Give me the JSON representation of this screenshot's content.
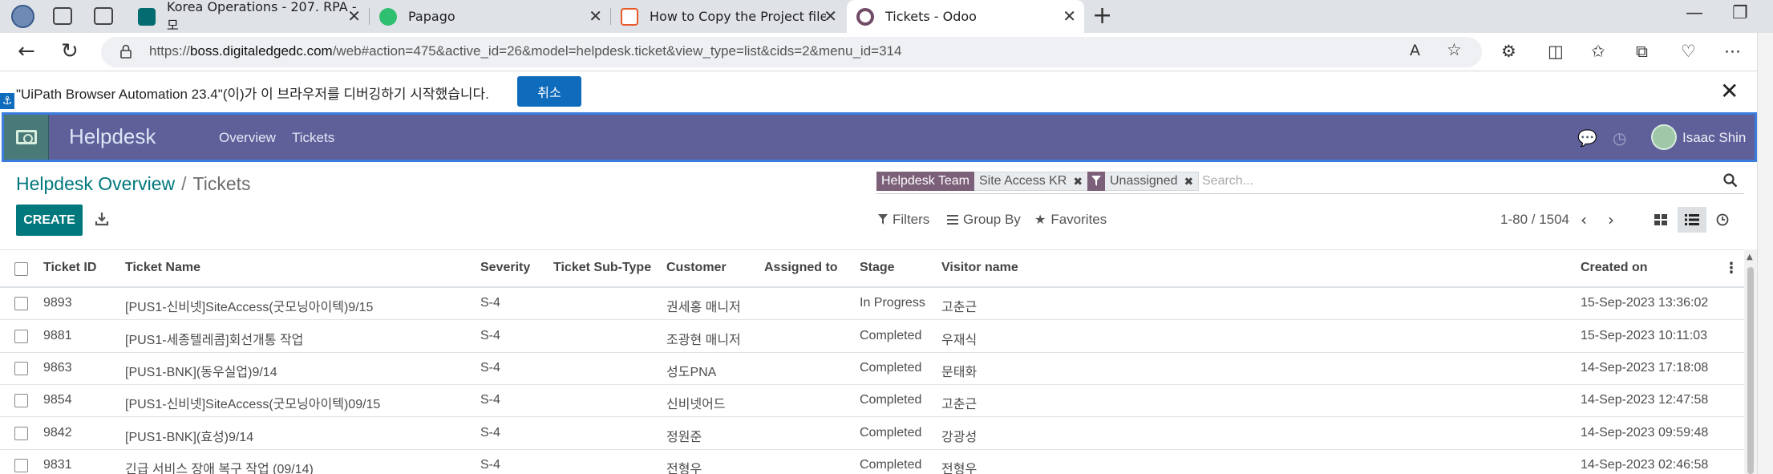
{
  "browser": {
    "tabs": [
      {
        "title": "Korea Operations - 207. RPA - 모",
        "favicon_color": "#036c70"
      },
      {
        "title": "Papago",
        "favicon_color": "#2fbf71"
      },
      {
        "title": "How to Copy the Project file in St",
        "favicon_color": "#e85a28"
      },
      {
        "title": "Tickets - Odoo",
        "favicon_color": "#714b67"
      }
    ],
    "active_tab": 3,
    "url_prefix": "https://",
    "url_host": "boss.digitaledgedc.com",
    "url_path": "/web#action=475&active_id=26&model=helpdesk.ticket&view_type=list&cids=2&menu_id=314"
  },
  "infobar": {
    "message": "\"UiPath Browser Automation 23.4\"(이)가 이 브라우저를 디버깅하기 시작했습니다.",
    "cancel_label": "취소"
  },
  "navbar": {
    "brand": "Helpdesk",
    "menu": [
      "Overview",
      "Tickets"
    ],
    "user": "Isaac Shin"
  },
  "breadcrumb": {
    "parent": "Helpdesk Overview",
    "separator": "/",
    "current": "Tickets"
  },
  "search": {
    "facets": [
      {
        "label": "Helpdesk Team",
        "value": "Site Access KR",
        "type": "field"
      },
      {
        "label": "",
        "value": "Unassigned",
        "type": "filter"
      }
    ],
    "placeholder": "Search..."
  },
  "toolbar": {
    "create_label": "CREATE",
    "filters_label": "Filters",
    "groupby_label": "Group By",
    "favorites_label": "Favorites",
    "pager": "1-80 / 1504"
  },
  "table": {
    "columns": [
      "Ticket ID",
      "Ticket Name",
      "Severity",
      "Ticket Sub-Type",
      "Customer",
      "Assigned to",
      "Stage",
      "Visitor name",
      "Created on"
    ],
    "rows": [
      {
        "id": "9893",
        "name": "[PUS1-신비넷]SiteAccess(굿모닝아이텍)9/15",
        "severity": "S-4",
        "subtype": "",
        "customer": "권세홍 매니저",
        "assigned": "",
        "stage": "In Progress",
        "visitor": "고춘근",
        "created": "15-Sep-2023 13:36:02"
      },
      {
        "id": "9881",
        "name": "[PUS1-세종텔레콤]회선개통 작업",
        "severity": "S-4",
        "subtype": "",
        "customer": "조광현 매니저",
        "assigned": "",
        "stage": "Completed",
        "visitor": "우재식",
        "created": "15-Sep-2023 10:11:03"
      },
      {
        "id": "9863",
        "name": "[PUS1-BNK](동우실업)9/14",
        "severity": "S-4",
        "subtype": "",
        "customer": "성도PNA",
        "assigned": "",
        "stage": "Completed",
        "visitor": "문태화",
        "created": "14-Sep-2023 17:18:08"
      },
      {
        "id": "9854",
        "name": "[PUS1-신비넷]SiteAccess(굿모닝아이텍)09/15",
        "severity": "S-4",
        "subtype": "",
        "customer": "신비넷어드",
        "assigned": "",
        "stage": "Completed",
        "visitor": "고춘근",
        "created": "14-Sep-2023 12:47:58"
      },
      {
        "id": "9842",
        "name": "[PUS1-BNK](효성)9/14",
        "severity": "S-4",
        "subtype": "",
        "customer": "정원준",
        "assigned": "",
        "stage": "Completed",
        "visitor": "강광성",
        "created": "14-Sep-2023 09:59:48"
      },
      {
        "id": "9831",
        "name": "긴급 서비스 장애 복구 작업 (09/14)",
        "severity": "S-4",
        "subtype": "",
        "customer": "전형우",
        "assigned": "",
        "stage": "Completed",
        "visitor": "전형우",
        "created": "14-Sep-2023 02:46:58"
      }
    ]
  }
}
